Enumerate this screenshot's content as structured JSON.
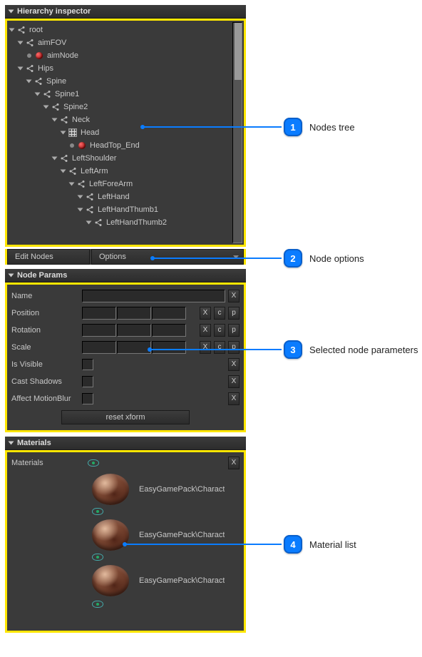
{
  "hierarchy": {
    "title": "Hierarchy inspector",
    "tree": [
      {
        "label": "root",
        "indent": 0,
        "expander": true,
        "icon": "share"
      },
      {
        "label": "aimFOV",
        "indent": 1,
        "expander": true,
        "icon": "share"
      },
      {
        "label": "aimNode",
        "indent": 2,
        "expander": false,
        "icon": "red"
      },
      {
        "label": "Hips",
        "indent": 1,
        "expander": true,
        "icon": "share"
      },
      {
        "label": "Spine",
        "indent": 2,
        "expander": true,
        "icon": "share"
      },
      {
        "label": "Spine1",
        "indent": 3,
        "expander": true,
        "icon": "share"
      },
      {
        "label": "Spine2",
        "indent": 4,
        "expander": true,
        "icon": "share"
      },
      {
        "label": "Neck",
        "indent": 5,
        "expander": true,
        "icon": "share"
      },
      {
        "label": "Head",
        "indent": 6,
        "expander": true,
        "icon": "grid"
      },
      {
        "label": "HeadTop_End",
        "indent": 7,
        "expander": false,
        "icon": "red"
      },
      {
        "label": "LeftShoulder",
        "indent": 5,
        "expander": true,
        "icon": "share"
      },
      {
        "label": "LeftArm",
        "indent": 6,
        "expander": true,
        "icon": "share"
      },
      {
        "label": "LeftForeArm",
        "indent": 7,
        "expander": true,
        "icon": "share"
      },
      {
        "label": "LeftHand",
        "indent": 8,
        "expander": true,
        "icon": "share"
      },
      {
        "label": "LeftHandThumb1",
        "indent": 8,
        "expander": true,
        "icon": "share"
      },
      {
        "label": "LeftHandThumb2",
        "indent": 9,
        "expander": true,
        "icon": "share"
      }
    ]
  },
  "toolbar": {
    "edit_nodes": "Edit Nodes",
    "options": "Options"
  },
  "node_params": {
    "title": "Node Params",
    "labels": {
      "name": "Name",
      "position": "Position",
      "rotation": "Rotation",
      "scale": "Scale",
      "is_visible": "Is Visible",
      "cast_shadows": "Cast Shadows",
      "affect_motionblur": "Affect MotionBlur"
    },
    "buttons": {
      "x": "X",
      "c": "c",
      "p": "p",
      "reset": "reset xform"
    }
  },
  "materials": {
    "title": "Materials",
    "label": "Materials",
    "x": "X",
    "items": [
      {
        "name": "EasyGamePack\\Charact"
      },
      {
        "name": "EasyGamePack\\Charact"
      },
      {
        "name": "EasyGamePack\\Charact"
      }
    ]
  },
  "callouts": {
    "1": {
      "num": "1",
      "text": "Nodes tree"
    },
    "2": {
      "num": "2",
      "text": "Node options"
    },
    "3": {
      "num": "3",
      "text": "Selected node parameters"
    },
    "4": {
      "num": "4",
      "text": "Material list"
    }
  }
}
